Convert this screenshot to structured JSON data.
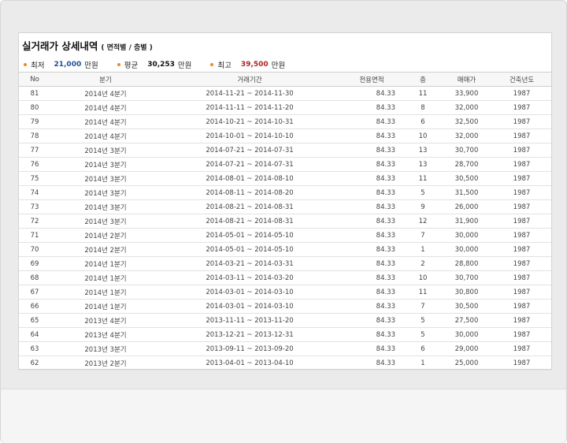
{
  "header": {
    "title": "실거래가 상세내역",
    "subtitle": "( 면적별 / 층별 )"
  },
  "summary": [
    {
      "label": "최저",
      "value": "21,000",
      "unit": "만원",
      "color": "#1f4e9c"
    },
    {
      "label": "평균",
      "value": "30,253",
      "unit": "만원",
      "color": "#111111"
    },
    {
      "label": "최고",
      "value": "39,500",
      "unit": "만원",
      "color": "#b21e1e"
    }
  ],
  "table": {
    "columns": [
      "No",
      "분기",
      "거래기간",
      "전용면적",
      "층",
      "매매가",
      "건축년도"
    ],
    "rows": [
      {
        "no": "81",
        "quarter": "2014년 4분기",
        "period": "2014-11-21 ~ 2014-11-30",
        "area": "84.33",
        "floor": "11",
        "price": "33,900",
        "year": "1987"
      },
      {
        "no": "80",
        "quarter": "2014년 4분기",
        "period": "2014-11-11 ~ 2014-11-20",
        "area": "84.33",
        "floor": "8",
        "price": "32,000",
        "year": "1987"
      },
      {
        "no": "79",
        "quarter": "2014년 4분기",
        "period": "2014-10-21 ~ 2014-10-31",
        "area": "84.33",
        "floor": "6",
        "price": "32,500",
        "year": "1987"
      },
      {
        "no": "78",
        "quarter": "2014년 4분기",
        "period": "2014-10-01 ~ 2014-10-10",
        "area": "84.33",
        "floor": "10",
        "price": "32,000",
        "year": "1987"
      },
      {
        "no": "77",
        "quarter": "2014년 3분기",
        "period": "2014-07-21 ~ 2014-07-31",
        "area": "84.33",
        "floor": "13",
        "price": "30,700",
        "year": "1987"
      },
      {
        "no": "76",
        "quarter": "2014년 3분기",
        "period": "2014-07-21 ~ 2014-07-31",
        "area": "84.33",
        "floor": "13",
        "price": "28,700",
        "year": "1987"
      },
      {
        "no": "75",
        "quarter": "2014년 3분기",
        "period": "2014-08-01 ~ 2014-08-10",
        "area": "84.33",
        "floor": "11",
        "price": "30,500",
        "year": "1987"
      },
      {
        "no": "74",
        "quarter": "2014년 3분기",
        "period": "2014-08-11 ~ 2014-08-20",
        "area": "84.33",
        "floor": "5",
        "price": "31,500",
        "year": "1987"
      },
      {
        "no": "73",
        "quarter": "2014년 3분기",
        "period": "2014-08-21 ~ 2014-08-31",
        "area": "84.33",
        "floor": "9",
        "price": "26,000",
        "year": "1987"
      },
      {
        "no": "72",
        "quarter": "2014년 3분기",
        "period": "2014-08-21 ~ 2014-08-31",
        "area": "84.33",
        "floor": "12",
        "price": "31,900",
        "year": "1987"
      },
      {
        "no": "71",
        "quarter": "2014년 2분기",
        "period": "2014-05-01 ~ 2014-05-10",
        "area": "84.33",
        "floor": "7",
        "price": "30,000",
        "year": "1987"
      },
      {
        "no": "70",
        "quarter": "2014년 2분기",
        "period": "2014-05-01 ~ 2014-05-10",
        "area": "84.33",
        "floor": "1",
        "price": "30,000",
        "year": "1987"
      },
      {
        "no": "69",
        "quarter": "2014년 1분기",
        "period": "2014-03-21 ~ 2014-03-31",
        "area": "84.33",
        "floor": "2",
        "price": "28,800",
        "year": "1987"
      },
      {
        "no": "68",
        "quarter": "2014년 1분기",
        "period": "2014-03-11 ~ 2014-03-20",
        "area": "84.33",
        "floor": "10",
        "price": "30,700",
        "year": "1987"
      },
      {
        "no": "67",
        "quarter": "2014년 1분기",
        "period": "2014-03-01 ~ 2014-03-10",
        "area": "84.33",
        "floor": "11",
        "price": "30,800",
        "year": "1987"
      },
      {
        "no": "66",
        "quarter": "2014년 1분기",
        "period": "2014-03-01 ~ 2014-03-10",
        "area": "84.33",
        "floor": "7",
        "price": "30,500",
        "year": "1987"
      },
      {
        "no": "65",
        "quarter": "2013년 4분기",
        "period": "2013-11-11 ~ 2013-11-20",
        "area": "84.33",
        "floor": "5",
        "price": "27,500",
        "year": "1987"
      },
      {
        "no": "64",
        "quarter": "2013년 4분기",
        "period": "2013-12-21 ~ 2013-12-31",
        "area": "84.33",
        "floor": "5",
        "price": "30,000",
        "year": "1987"
      },
      {
        "no": "63",
        "quarter": "2013년 3분기",
        "period": "2013-09-11 ~ 2013-09-20",
        "area": "84.33",
        "floor": "6",
        "price": "29,000",
        "year": "1987"
      },
      {
        "no": "62",
        "quarter": "2013년 2분기",
        "period": "2013-04-01 ~ 2013-04-10",
        "area": "84.33",
        "floor": "1",
        "price": "25,000",
        "year": "1987"
      }
    ]
  }
}
